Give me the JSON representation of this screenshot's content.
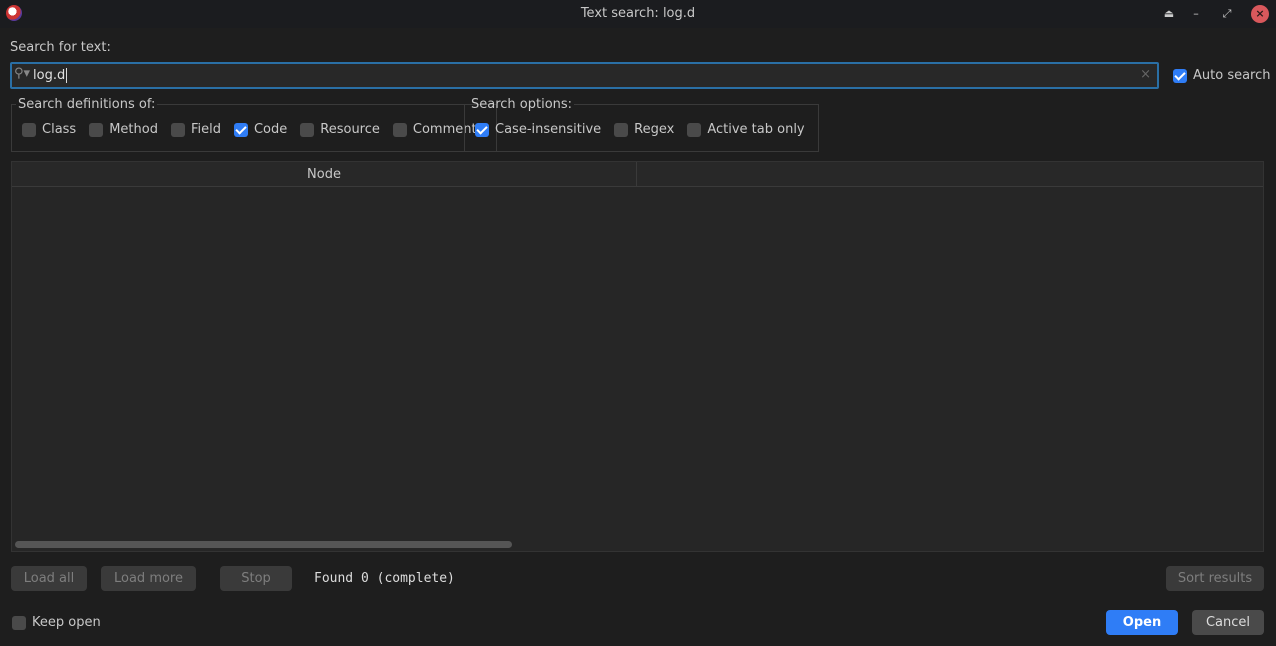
{
  "window": {
    "title": "Text search: log.d",
    "logo": "jadx-logo"
  },
  "search": {
    "label": "Search for text:",
    "value": "log.d",
    "auto_search_label": "Auto search",
    "auto_search": true
  },
  "definitions": {
    "legend": "Search definitions of:",
    "items": [
      {
        "label": "Class",
        "checked": false
      },
      {
        "label": "Method",
        "checked": false
      },
      {
        "label": "Field",
        "checked": false
      },
      {
        "label": "Code",
        "checked": true
      },
      {
        "label": "Resource",
        "checked": false
      },
      {
        "label": "Comments",
        "checked": false
      }
    ]
  },
  "options": {
    "legend": "Search options:",
    "items": [
      {
        "label": "Case-insensitive",
        "checked": true
      },
      {
        "label": "Regex",
        "checked": false
      },
      {
        "label": "Active tab only",
        "checked": false
      }
    ]
  },
  "table": {
    "columns": [
      "Node",
      ""
    ]
  },
  "buttons": {
    "load_all": "Load all",
    "load_more": "Load more",
    "stop": "Stop",
    "sort_results": "Sort results",
    "open": "Open",
    "cancel": "Cancel"
  },
  "status": "Found 0 (complete)",
  "keep_open": {
    "label": "Keep open",
    "checked": false
  },
  "colors": {
    "accent": "#2f7df6",
    "focus_border": "#2a6fa5",
    "close": "#d9585c"
  }
}
